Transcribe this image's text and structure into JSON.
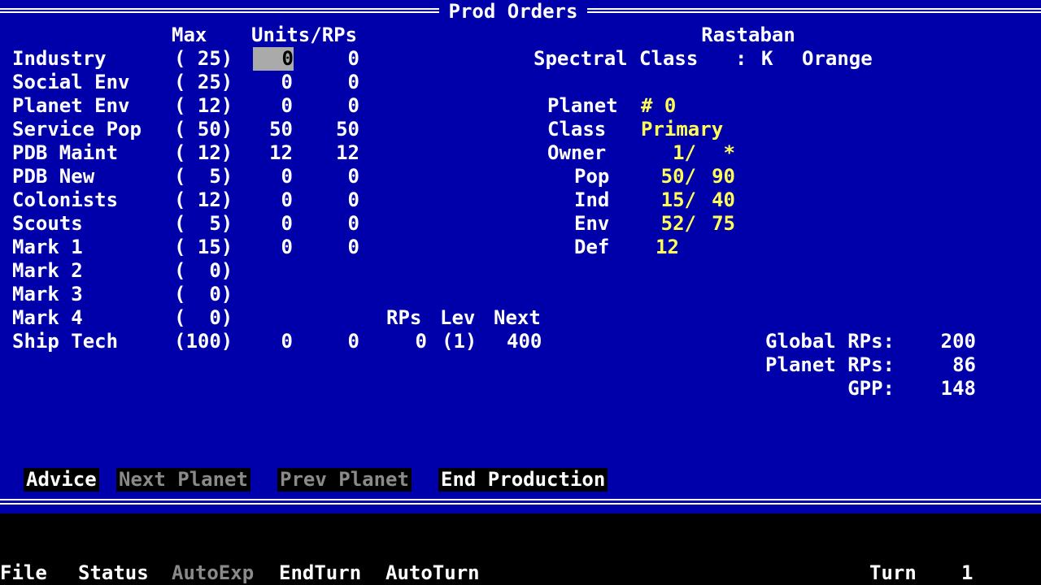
{
  "window": {
    "title": "Prod Orders"
  },
  "headers": {
    "max": "Max",
    "units_rps": "Units/RPs"
  },
  "orders": [
    {
      "label": "Industry",
      "max": "( 25)",
      "units": "0",
      "rps": "0"
    },
    {
      "label": "Social Env",
      "max": "( 25)",
      "units": "0",
      "rps": "0"
    },
    {
      "label": "Planet Env",
      "max": "( 12)",
      "units": "0",
      "rps": "0"
    },
    {
      "label": "Service Pop",
      "max": "( 50)",
      "units": "50",
      "rps": "50"
    },
    {
      "label": "PDB Maint",
      "max": "( 12)",
      "units": "12",
      "rps": "12"
    },
    {
      "label": "PDB New",
      "max": "(  5)",
      "units": "0",
      "rps": "0"
    },
    {
      "label": "Colonists",
      "max": "( 12)",
      "units": "0",
      "rps": "0"
    },
    {
      "label": "Scouts",
      "max": "(  5)",
      "units": "0",
      "rps": "0"
    },
    {
      "label": "Mark 1",
      "max": "( 15)",
      "units": "0",
      "rps": "0"
    },
    {
      "label": "Mark 2",
      "max": "(  0)"
    },
    {
      "label": "Mark 3",
      "max": "(  0)"
    },
    {
      "label": "Mark 4",
      "max": "(  0)"
    }
  ],
  "ship_tech": {
    "label": "Ship Tech",
    "max": "(100)",
    "units": "0",
    "rps": "0",
    "col_rps": "RPs",
    "col_lev": "Lev",
    "col_next": "Next",
    "rps_val": "0",
    "lev_val": "(1)",
    "next_val": "400"
  },
  "star": {
    "name": "Rastaban",
    "spectral_label": "Spectral Class",
    "sep": ":",
    "spectral_class": "K",
    "color": "Orange"
  },
  "planet": {
    "planet_label": "Planet",
    "planet_value": "# 0",
    "class_label": "Class",
    "class_value": "Primary",
    "owner_label": "Owner",
    "owner_a": "1/",
    "owner_b": "*",
    "pop_label": "Pop",
    "pop_a": "50/",
    "pop_b": "90",
    "ind_label": "Ind",
    "ind_a": "15/",
    "ind_b": "40",
    "env_label": "Env",
    "env_a": "52/",
    "env_b": "75",
    "def_label": "Def",
    "def_value": "12"
  },
  "totals": {
    "global_label": "Global RPs:",
    "global_value": "200",
    "planet_label": "Planet RPs:",
    "planet_value": "86",
    "gpp_label": "GPP:",
    "gpp_value": "148"
  },
  "buttons": {
    "advice": "Advice",
    "next_planet": "Next Planet",
    "prev_planet": "Prev Planet",
    "end_production": "End Production"
  },
  "menu": {
    "file": "File",
    "status": "Status",
    "autoexp": "AutoExp",
    "endturn": "EndTurn",
    "autoturn": "AutoTurn",
    "turn_label": "Turn",
    "turn_value": "1"
  },
  "colors": {
    "panel_bg": "#0000aa",
    "highlight_text": "#ffff55",
    "cursor_bg": "#aaaaaa",
    "disabled_text": "#8a8a8a"
  }
}
